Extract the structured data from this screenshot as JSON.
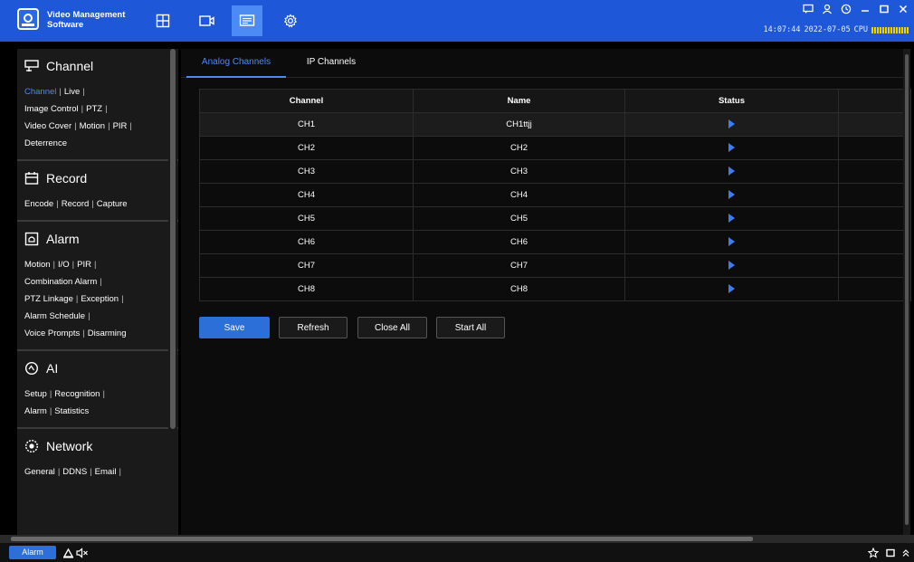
{
  "app": {
    "title_line1": "Video Management",
    "title_line2": "Software",
    "logo_icon": "webcam-logo-icon"
  },
  "top_tabs": [
    {
      "icon": "grid-view-icon",
      "active": false
    },
    {
      "icon": "playback-icon",
      "active": false
    },
    {
      "icon": "device-icon",
      "active": true
    },
    {
      "icon": "settings-gear-icon",
      "active": false
    }
  ],
  "system": {
    "icons": [
      "chat-icon",
      "user-icon",
      "clock-icon",
      "minimize-icon",
      "maximize-icon",
      "close-icon"
    ],
    "time": "14:07:44",
    "date": "2022-07-05",
    "cpu_label": "CPU"
  },
  "sidebar": {
    "sections": [
      {
        "title": "Channel",
        "icon": "channel-icon",
        "lines": [
          [
            "Channel",
            "Live"
          ],
          [
            "Image Control",
            "PTZ"
          ],
          [
            "Video Cover",
            "Motion",
            "PIR"
          ],
          [
            "Deterrence"
          ]
        ]
      },
      {
        "title": "Record",
        "icon": "record-icon",
        "lines": [
          [
            "Encode",
            "Record",
            "Capture"
          ]
        ]
      },
      {
        "title": "Alarm",
        "icon": "alarm-icon",
        "lines": [
          [
            "Motion",
            "I/O",
            "PIR"
          ],
          [
            "Combination Alarm"
          ],
          [
            "PTZ Linkage",
            "Exception"
          ],
          [
            "Alarm Schedule"
          ],
          [
            "Voice Prompts",
            "Disarming"
          ]
        ]
      },
      {
        "title": "AI",
        "icon": "ai-icon",
        "lines": [
          [
            "Setup",
            "Recognition"
          ],
          [
            "Alarm",
            "Statistics"
          ]
        ]
      },
      {
        "title": "Network",
        "icon": "network-icon",
        "lines": [
          [
            "General",
            "DDNS",
            "Email"
          ]
        ]
      }
    ],
    "active_item": "Channel"
  },
  "tabs": {
    "analog": "Analog Channels",
    "ip": "IP Channels",
    "active": "analog"
  },
  "table": {
    "headers": [
      "Channel",
      "Name",
      "Status"
    ],
    "rows": [
      {
        "channel": "CH1",
        "name": "CH1ttjj",
        "status": "play-icon"
      },
      {
        "channel": "CH2",
        "name": "CH2",
        "status": "play-icon"
      },
      {
        "channel": "CH3",
        "name": "CH3",
        "status": "play-icon"
      },
      {
        "channel": "CH4",
        "name": "CH4",
        "status": "play-icon"
      },
      {
        "channel": "CH5",
        "name": "CH5",
        "status": "play-icon"
      },
      {
        "channel": "CH6",
        "name": "CH6",
        "status": "play-icon"
      },
      {
        "channel": "CH7",
        "name": "CH7",
        "status": "play-icon"
      },
      {
        "channel": "CH8",
        "name": "CH8",
        "status": "play-icon"
      }
    ]
  },
  "actions": {
    "save": "Save",
    "refresh": "Refresh",
    "close_all": "Close All",
    "start_all": "Start All"
  },
  "bottom": {
    "alarm": "Alarm",
    "left_icons": [
      "alarm-bell-icon",
      "mute-icon"
    ],
    "right_icons": [
      "pin-icon",
      "window-icon",
      "collapse-icon"
    ]
  },
  "colors": {
    "titlebar": "#1e58d9",
    "accent": "#4b8bf3",
    "button_primary": "#2d6fd8",
    "cpu_meter": "#f0d000"
  }
}
